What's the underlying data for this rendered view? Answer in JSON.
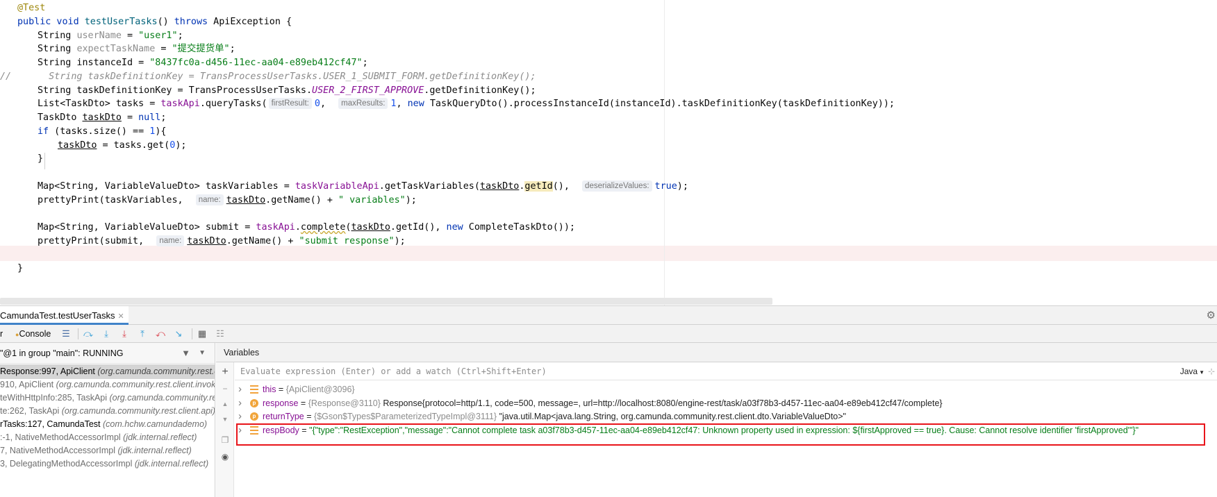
{
  "editor": {
    "lines": [
      {
        "html": "<span class=\"ann\">@Test</span>",
        "indent": 0
      },
      {
        "html": "<span class=\"kw\">public void</span> <span style=\"color:#00627a\">testUserTasks</span>() <span class=\"kw\">throws</span> ApiException {",
        "indent": 0
      },
      {
        "html": "String <span class=\"param-def\">userName</span> = <span class=\"str\">\"user1\"</span>;",
        "indent": 1
      },
      {
        "html": "String <span class=\"param-def\">expectTaskName</span> = <span class=\"str\">\"提交提货单\"</span>;",
        "indent": 1
      },
      {
        "html": "String instanceId = <span class=\"str\">\"8437fc0a-d456-11ec-aa04-e89eb412cf47\"</span>;",
        "indent": 1
      },
      {
        "html": "<span class=\"cmt\">  String taskDefinitionKey = TransProcessUserTasks.USER_1_SUBMIT_FORM.getDefinitionKey();</span>",
        "indent": 1,
        "comment_prefix": "//"
      },
      {
        "html": "String taskDefinitionKey = TransProcessUserTasks.<span class=\"const\">USER_2_FIRST_APPROVE</span>.getDefinitionKey();",
        "indent": 1
      },
      {
        "html": "List&lt;TaskDto&gt; tasks = <span class=\"field\">taskApi</span>.queryTasks(<span class=\"hint\">firstResult:</span><span class=\"num\">0</span>,  <span class=\"hint\">maxResults:</span><span class=\"num\">1</span>, <span class=\"kw\">new</span> TaskQueryDto().processInstanceId(instanceId).taskDefinitionKey(taskDefinitionKey));",
        "indent": 1
      },
      {
        "html": "TaskDto <span class=\"ul\">taskDto</span> = <span class=\"kw\">null</span>;",
        "indent": 1
      },
      {
        "html": "<span class=\"kw\">if</span> (tasks.size() == <span class=\"num\">1</span>){",
        "indent": 1
      },
      {
        "html": "<span class=\"ul\">taskDto</span> = tasks.get(<span class=\"num\">0</span>);",
        "indent": 2
      },
      {
        "html": "}",
        "indent": 1
      },
      {
        "html": "",
        "indent": 0
      },
      {
        "html": "Map&lt;String, VariableValueDto&gt; taskVariables = <span class=\"field\">taskVariableApi</span>.getTaskVariables(<span class=\"ul\">taskDto</span>.<span class=\"id-hl\">getId</span>(),  <span class=\"hint\">deserializeValues:</span><span class=\"kw\">true</span>);",
        "indent": 1
      },
      {
        "html": "prettyPrint(taskVariables,  <span class=\"hint\">name:</span><span class=\"ul\">taskDto</span>.getName() + <span class=\"str\">\" variables\"</span>);",
        "indent": 1
      },
      {
        "html": "",
        "indent": 0
      },
      {
        "html": "Map&lt;String, VariableValueDto&gt; submit = <span class=\"field\">taskApi</span>.<span class=\"warn\">complete</span>(<span class=\"ul\">taskDto</span>.getId(), <span class=\"kw\">new</span> CompleteTaskDto());",
        "indent": 1
      },
      {
        "html": "prettyPrint(submit,  <span class=\"hint\">name:</span><span class=\"ul\">taskDto</span>.getName() + <span class=\"str\">\"submit response\"</span>);",
        "indent": 1
      },
      {
        "html": "",
        "indent": 0
      },
      {
        "html": "}",
        "indent": 0
      }
    ]
  },
  "debug": {
    "session_tab": "CamundaTest.testUserTasks",
    "toolbar": {
      "debugger_tab_fragment": "r",
      "console_tab": "Console"
    },
    "thread_label": "\"@1 in group \"main\": RUNNING",
    "frames": [
      {
        "method": "Response:997, ApiClient ",
        "loc": "(org.camunda.community.rest.client.invoker)",
        "state": "selected"
      },
      {
        "method": "910, ApiClient ",
        "loc": "(org.camunda.community.rest.client.invoker)",
        "state": "lib"
      },
      {
        "method": "teWithHttpInfo:285, TaskApi ",
        "loc": "(org.camunda.community.rest.client.api)",
        "state": "lib"
      },
      {
        "method": "te:262, TaskApi ",
        "loc": "(org.camunda.community.rest.client.api)",
        "state": "lib"
      },
      {
        "method": "rTasks:127, CamundaTest ",
        "loc": "(com.hchw.camundademo)",
        "state": "user"
      },
      {
        "method": ":-1, NativeMethodAccessorImpl ",
        "loc": "(jdk.internal.reflect)",
        "state": "lib"
      },
      {
        "method": "7, NativeMethodAccessorImpl ",
        "loc": "(jdk.internal.reflect)",
        "state": "lib"
      },
      {
        "method": "3, DelegatingMethodAccessorImpl ",
        "loc": "(jdk.internal.reflect)",
        "state": "lib"
      }
    ],
    "variables": {
      "header": "Variables",
      "eval_placeholder": "Evaluate expression (Enter) or add a watch (Ctrl+Shift+Enter)",
      "language": "Java",
      "rows": [
        {
          "icon": "field",
          "name": "this",
          "eq": " = ",
          "id": "{ApiClient@3096}",
          "value": "",
          "value_class": "vval"
        },
        {
          "icon": "p",
          "name": "response",
          "eq": " = ",
          "id": "{Response@3110}",
          "value": " Response{protocol=http/1.1, code=500, message=, url=http://localhost:8080/engine-rest/task/a03f78b3-d457-11ec-aa04-e89eb412cf47/complete}",
          "value_class": "vval"
        },
        {
          "icon": "p",
          "name": "returnType",
          "eq": " = ",
          "id": "{$Gson$Types$ParameterizedTypeImpl@3111}",
          "value": " \"java.util.Map<java.lang.String, org.camunda.community.rest.client.dto.VariableValueDto>\"",
          "value_class": "vval"
        },
        {
          "icon": "field",
          "name": "respBody",
          "eq": " = ",
          "id": "",
          "value": "\"{\"type\":\"RestException\",\"message\":\"Cannot complete task a03f78b3-d457-11ec-aa04-e89eb412cf47: Unknown property used in expression: ${firstApproved == true}. Cause: Cannot resolve identifier 'firstApproved'\"}\"",
          "value_class": "vstr"
        }
      ]
    }
  }
}
